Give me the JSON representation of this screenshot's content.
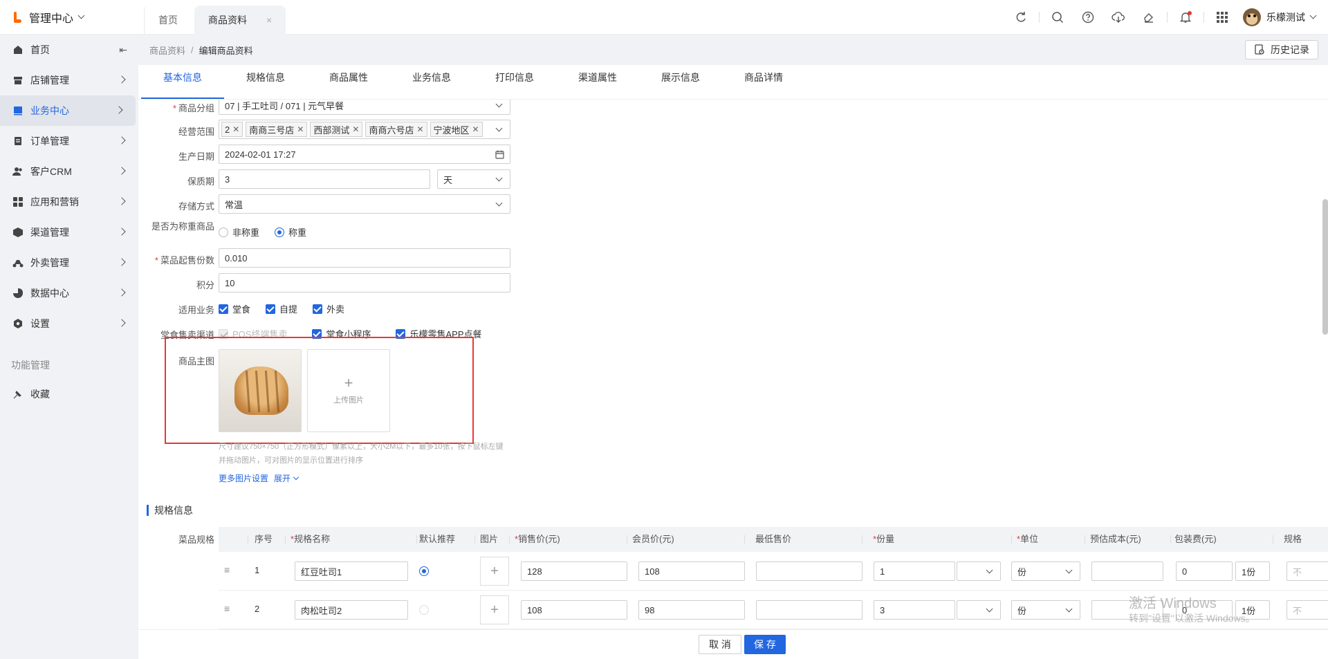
{
  "app": {
    "title": "管理中心"
  },
  "tabs": [
    {
      "label": "首页"
    },
    {
      "label": "商品资料",
      "close": "×"
    }
  ],
  "user": {
    "name": "乐檬测试"
  },
  "sidebar": {
    "items": [
      {
        "label": "首页",
        "icon": "home-icon"
      },
      {
        "label": "店铺管理",
        "icon": "store-icon"
      },
      {
        "label": "业务中心",
        "icon": "business-icon"
      },
      {
        "label": "订单管理",
        "icon": "order-icon"
      },
      {
        "label": "客户CRM",
        "icon": "users-icon"
      },
      {
        "label": "应用和营销",
        "icon": "apps-icon"
      },
      {
        "label": "渠道管理",
        "icon": "cube-icon"
      },
      {
        "label": "外卖管理",
        "icon": "scooter-icon"
      },
      {
        "label": "数据中心",
        "icon": "pie-chart-icon"
      },
      {
        "label": "设置",
        "icon": "gear-icon"
      }
    ],
    "section": "功能管理",
    "favorite": "收藏"
  },
  "breadcrumb": {
    "parent": "商品资料",
    "sep": "/",
    "current": "编辑商品资料"
  },
  "history_label": "历史记录",
  "subtabs": [
    "基本信息",
    "规格信息",
    "商品属性",
    "业务信息",
    "打印信息",
    "渠道属性",
    "展示信息",
    "商品详情"
  ],
  "form": {
    "group": {
      "label": "商品分组",
      "value": "07 | 手工吐司 / 071 | 元气早餐"
    },
    "scope": {
      "label": "经营范围",
      "tags": [
        "2",
        "南商三号店",
        "西部测试",
        "南商六号店",
        "宁波地区"
      ]
    },
    "prod_date": {
      "label": "生产日期",
      "value": "2024-02-01 17:27"
    },
    "shelf": {
      "label": "保质期",
      "value": "3",
      "unit": "天"
    },
    "storage": {
      "label": "存储方式",
      "value": "常温"
    },
    "weigh": {
      "label": "是否为称重商品",
      "options": [
        "非称重",
        "称重"
      ],
      "selected": "称重"
    },
    "min_qty": {
      "label": "菜品起售份数",
      "value": "0.010"
    },
    "points": {
      "label": "积分",
      "value": "10"
    },
    "business": {
      "label": "适用业务",
      "options": [
        "堂食",
        "自提",
        "外卖"
      ]
    },
    "channels": {
      "label": "堂食售卖渠道",
      "options": [
        "POS终端售卖",
        "堂食小程序",
        "乐檬零售APP点餐"
      ]
    },
    "main_image": {
      "label": "商品主图",
      "upload": "上传图片"
    },
    "image_hint": "尺寸建议750×750（正方形模式）像素以上，大小2M以下，最多10张，按下鼠标左键并拖动图片，可对图片的显示位置进行排序",
    "more_image": "更多图片设置",
    "expand": "展开"
  },
  "spec": {
    "section_title": "规格信息",
    "label": "菜品规格",
    "headers": [
      "序号",
      "*规格名称",
      "默认推荐",
      "图片",
      "*销售价(元)",
      "会员价(元)",
      "最低售价",
      "*份量",
      "*单位",
      "预估成本(元)",
      "包装费(元)",
      "规格"
    ],
    "rows": [
      {
        "no": "1",
        "name": "红豆吐司1",
        "default": true,
        "price": "128",
        "member": "108",
        "min": "",
        "qty": "1",
        "unit": "份",
        "cost": "",
        "pack": "0",
        "pack_unit": "1份",
        "extra": "不"
      },
      {
        "no": "2",
        "name": "肉松吐司2",
        "default": false,
        "price": "108",
        "member": "98",
        "min": "",
        "qty": "3",
        "unit": "份",
        "cost": "",
        "pack": "0",
        "pack_unit": "1份",
        "extra": "不"
      }
    ]
  },
  "footer": {
    "cancel": "取 消",
    "save": "保 存"
  },
  "watermark": {
    "line1": "激活 Windows",
    "line2": "转到\"设置\"以激活 Windows。"
  },
  "colors": {
    "primary": "#2266e0",
    "brand": "#ff6a00",
    "required": "#e53935"
  }
}
